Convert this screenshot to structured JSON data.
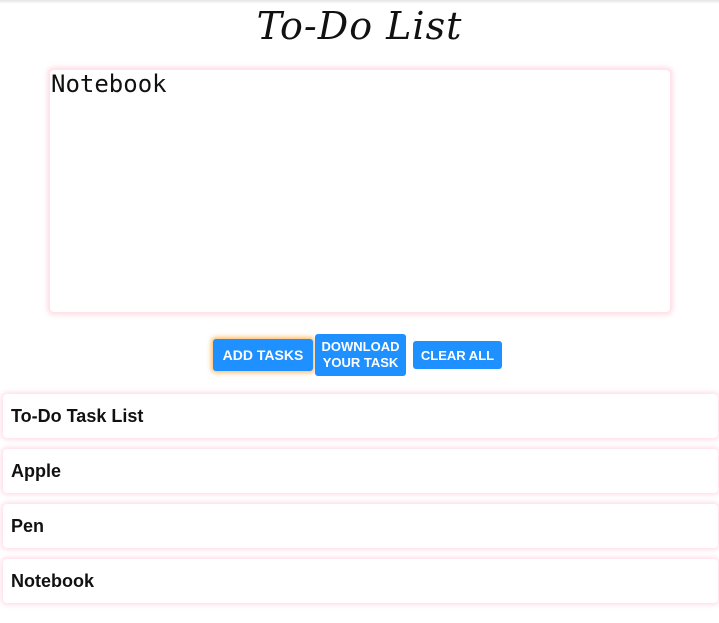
{
  "header": {
    "title": "To-Do List"
  },
  "task_input": {
    "value": "Notebook",
    "placeholder": ""
  },
  "buttons": {
    "add_label": "ADD TASKS",
    "download_label_line1": "DOWNLOAD",
    "download_label_line2": "YOUR TASK",
    "clear_label": "CLEAR ALL"
  },
  "task_list": {
    "heading": "To-Do Task List",
    "items": [
      {
        "label": "Apple"
      },
      {
        "label": "Pen"
      },
      {
        "label": "Notebook"
      }
    ]
  },
  "colors": {
    "button_background": "#1e90ff",
    "button_text": "#ffffff",
    "add_button_glow": "#ffaa3c",
    "card_glow": "#ffb9cd"
  }
}
